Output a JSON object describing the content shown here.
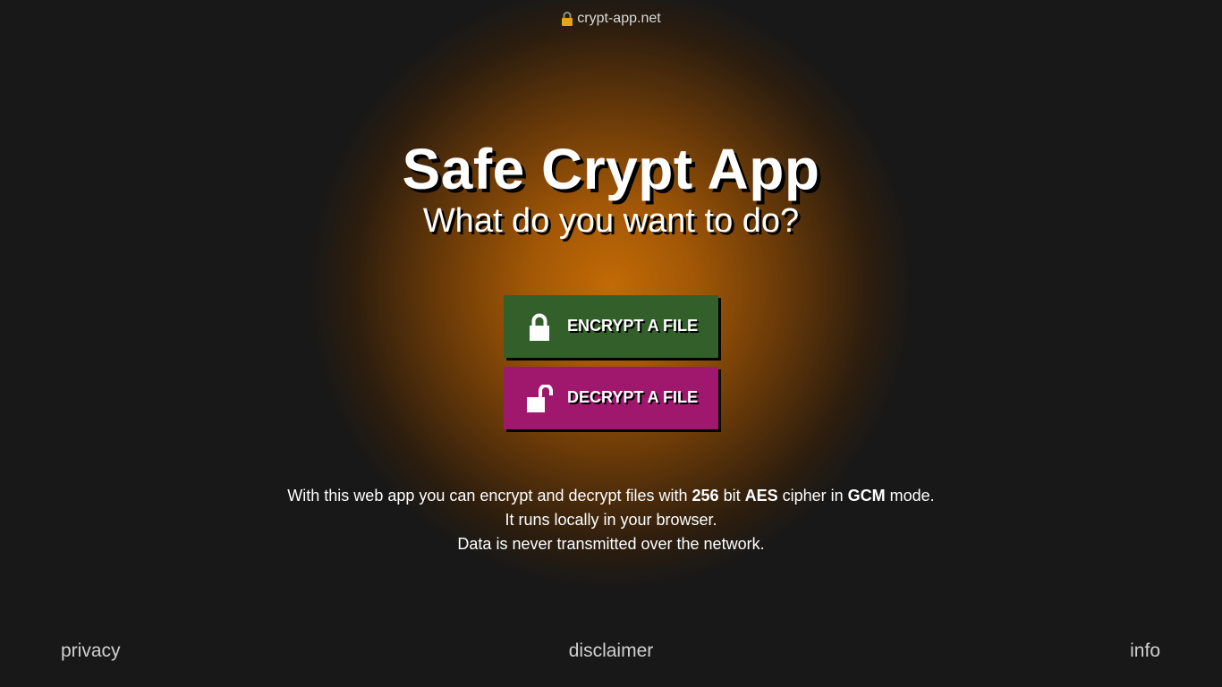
{
  "header": {
    "domain": "crypt-app.net",
    "lock_icon": "lock-icon",
    "lock_color": "#e8a317"
  },
  "main": {
    "title": "Safe Crypt App",
    "subtitle": "What do you want to do?",
    "encrypt_button": {
      "label": "ENCRYPT A FILE",
      "icon": "lock-icon",
      "color": "#33602a"
    },
    "decrypt_button": {
      "label": "DECRYPT A FILE",
      "icon": "unlock-icon",
      "color": "#a0186e"
    }
  },
  "description": {
    "line1_part1": "With this web app you can encrypt and decrypt files with ",
    "line1_bits": "256",
    "line1_part2": " bit ",
    "line1_cipher": "AES",
    "line1_part3": " cipher in ",
    "line1_mode": "GCM",
    "line1_part4": " mode.",
    "line2": "It runs locally in your browser.",
    "line3": "Data is never transmitted over the network."
  },
  "footer": {
    "privacy": "privacy",
    "disclaimer": "disclaimer",
    "info": "info"
  },
  "colors": {
    "background": "#181818",
    "glow": "#c26a06"
  }
}
